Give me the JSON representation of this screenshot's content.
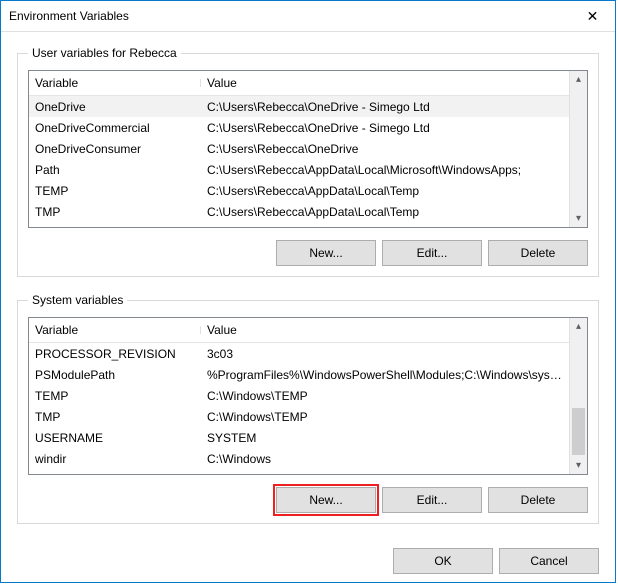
{
  "window": {
    "title": "Environment Variables"
  },
  "user_group": {
    "legend": "User variables for Rebecca",
    "columns": {
      "variable": "Variable",
      "value": "Value"
    },
    "rows": [
      {
        "variable": "OneDrive",
        "value": "C:\\Users\\Rebecca\\OneDrive - Simego Ltd",
        "selected": true
      },
      {
        "variable": "OneDriveCommercial",
        "value": "C:\\Users\\Rebecca\\OneDrive - Simego Ltd"
      },
      {
        "variable": "OneDriveConsumer",
        "value": "C:\\Users\\Rebecca\\OneDrive"
      },
      {
        "variable": "Path",
        "value": "C:\\Users\\Rebecca\\AppData\\Local\\Microsoft\\WindowsApps;"
      },
      {
        "variable": "TEMP",
        "value": "C:\\Users\\Rebecca\\AppData\\Local\\Temp"
      },
      {
        "variable": "TMP",
        "value": "C:\\Users\\Rebecca\\AppData\\Local\\Temp"
      }
    ],
    "buttons": {
      "new": "New...",
      "edit": "Edit...",
      "delete": "Delete"
    }
  },
  "system_group": {
    "legend": "System variables",
    "columns": {
      "variable": "Variable",
      "value": "Value"
    },
    "rows": [
      {
        "variable": "PROCESSOR_REVISION",
        "value": "3c03"
      },
      {
        "variable": "PSModulePath",
        "value": "%ProgramFiles%\\WindowsPowerShell\\Modules;C:\\Windows\\syste..."
      },
      {
        "variable": "TEMP",
        "value": "C:\\Windows\\TEMP"
      },
      {
        "variable": "TMP",
        "value": "C:\\Windows\\TEMP"
      },
      {
        "variable": "USERNAME",
        "value": "SYSTEM"
      },
      {
        "variable": "windir",
        "value": "C:\\Windows"
      }
    ],
    "buttons": {
      "new": "New...",
      "edit": "Edit...",
      "delete": "Delete"
    }
  },
  "dialog_buttons": {
    "ok": "OK",
    "cancel": "Cancel"
  }
}
